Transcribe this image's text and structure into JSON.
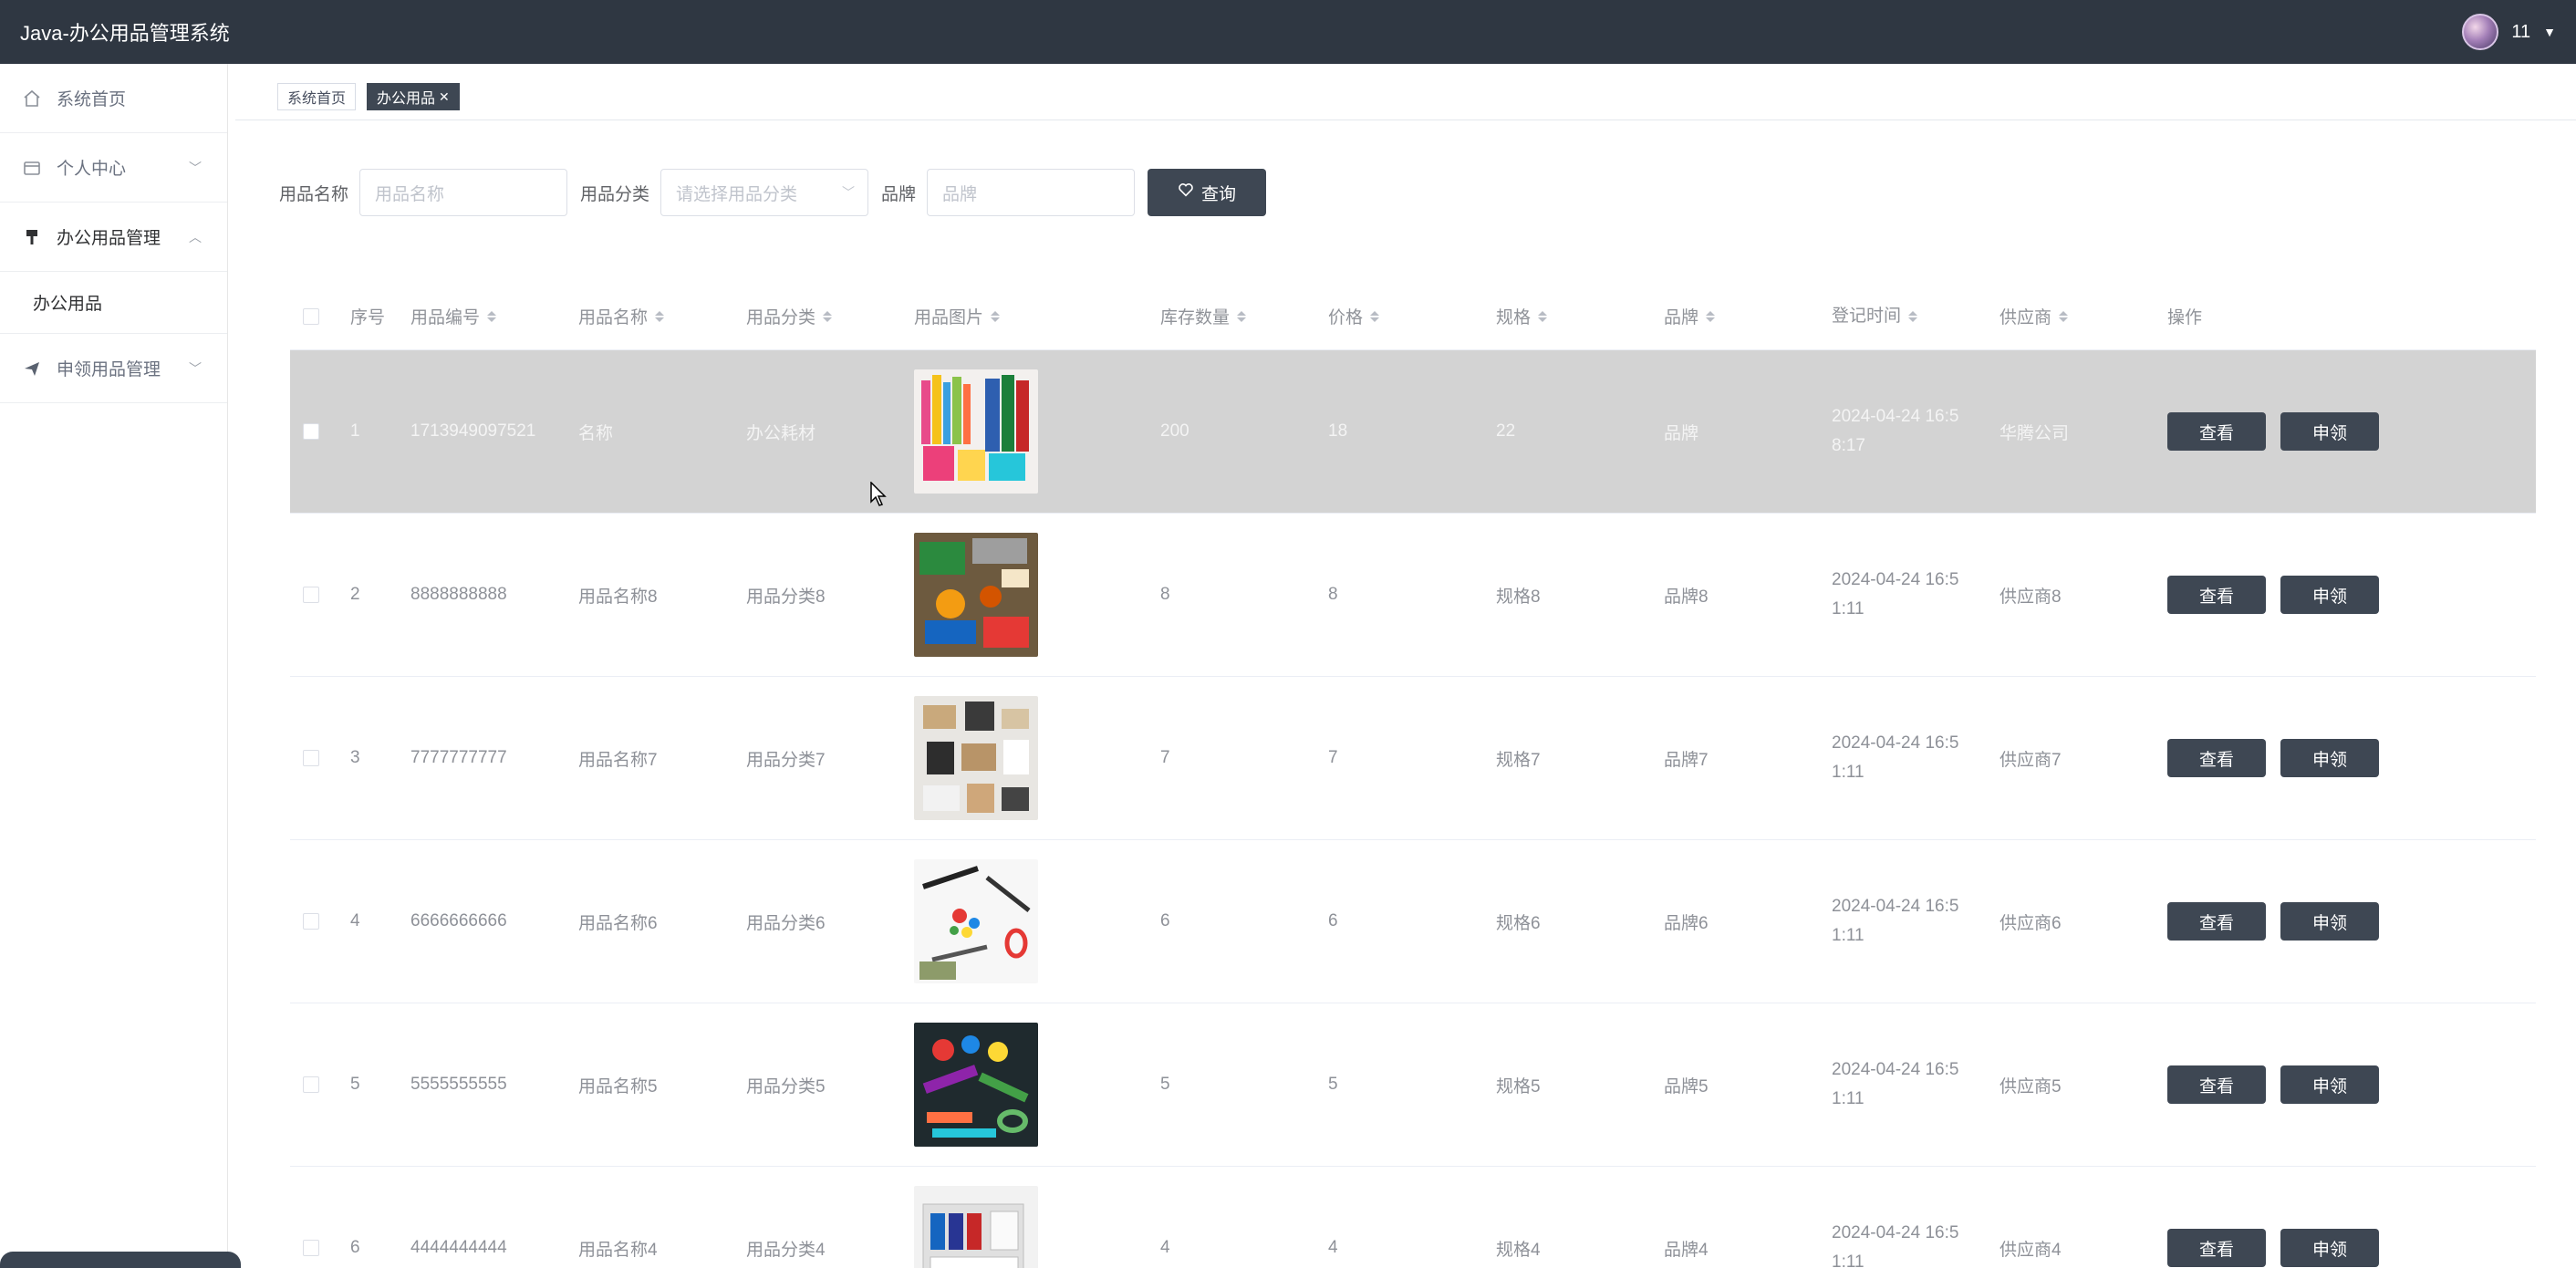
{
  "app": {
    "title": "Java-办公用品管理系统",
    "user_name": "11"
  },
  "sidebar": {
    "items": [
      {
        "label": "系统首页",
        "icon": "home-icon"
      },
      {
        "label": "个人中心",
        "icon": "card-icon"
      },
      {
        "label": "办公用品管理",
        "icon": "brush-icon"
      },
      {
        "label": "申领用品管理",
        "icon": "paper-plane-icon"
      }
    ],
    "sub_active": "办公用品"
  },
  "tags": {
    "home": "系统首页",
    "active": "办公用品",
    "close": "✕"
  },
  "search": {
    "name_label": "用品名称",
    "name_placeholder": "用品名称",
    "category_label": "用品分类",
    "category_placeholder": "请选择用品分类",
    "brand_label": "品牌",
    "brand_placeholder": "品牌",
    "button_label": "查询"
  },
  "table": {
    "headers": {
      "index": "序号",
      "code": "用品编号",
      "name": "用品名称",
      "category": "用品分类",
      "image": "用品图片",
      "stock": "库存数量",
      "price": "价格",
      "spec": "规格",
      "brand": "品牌",
      "time": "登记时间",
      "supplier": "供应商",
      "ops": "操作"
    },
    "view_label": "查看",
    "apply_label": "申领",
    "rows": [
      {
        "index": "1",
        "code": "1713949097521",
        "name": "名称",
        "category": "办公耗材",
        "stock": "200",
        "price": "18",
        "spec": "22",
        "brand": "品牌",
        "time_line1": "2024-04-24 16:5",
        "time_line2": "8:17",
        "supplier": "华腾公司"
      },
      {
        "index": "2",
        "code": "8888888888",
        "name": "用品名称8",
        "category": "用品分类8",
        "stock": "8",
        "price": "8",
        "spec": "规格8",
        "brand": "品牌8",
        "time_line1": "2024-04-24 16:5",
        "time_line2": "1:11",
        "supplier": "供应商8"
      },
      {
        "index": "3",
        "code": "7777777777",
        "name": "用品名称7",
        "category": "用品分类7",
        "stock": "7",
        "price": "7",
        "spec": "规格7",
        "brand": "品牌7",
        "time_line1": "2024-04-24 16:5",
        "time_line2": "1:11",
        "supplier": "供应商7"
      },
      {
        "index": "4",
        "code": "6666666666",
        "name": "用品名称6",
        "category": "用品分类6",
        "stock": "6",
        "price": "6",
        "spec": "规格6",
        "brand": "品牌6",
        "time_line1": "2024-04-24 16:5",
        "time_line2": "1:11",
        "supplier": "供应商6"
      },
      {
        "index": "5",
        "code": "5555555555",
        "name": "用品名称5",
        "category": "用品分类5",
        "stock": "5",
        "price": "5",
        "spec": "规格5",
        "brand": "品牌5",
        "time_line1": "2024-04-24 16:5",
        "time_line2": "1:11",
        "supplier": "供应商5"
      },
      {
        "index": "6",
        "code": "4444444444",
        "name": "用品名称4",
        "category": "用品分类4",
        "stock": "4",
        "price": "4",
        "spec": "规格4",
        "brand": "品牌4",
        "time_line1": "2024-04-24 16:5",
        "time_line2": "1:11",
        "supplier": "供应商4"
      }
    ]
  },
  "colors": {
    "topbar": "#2f3742",
    "accent_button": "#3e4753",
    "row_highlight": "#d3d3d3"
  }
}
